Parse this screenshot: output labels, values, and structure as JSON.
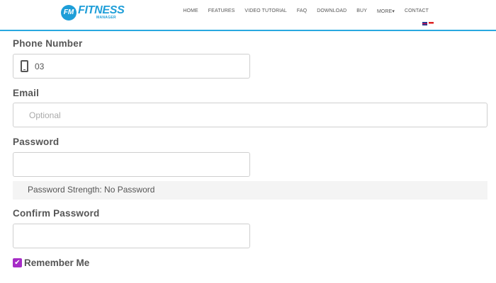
{
  "header": {
    "logo_badge": "FM",
    "logo_word": "FITNESS",
    "logo_sub": "MANAGER",
    "nav": [
      "HOME",
      "FEATURES",
      "VIDEO TUTORIAL",
      "FAQ",
      "DOWNLOAD",
      "BUY",
      "MORE▾",
      "CONTACT"
    ],
    "accent_color": "#29a8e0"
  },
  "form": {
    "phone": {
      "label": "Phone Number",
      "value": "03",
      "icon": "phone-icon"
    },
    "email": {
      "label": "Email",
      "placeholder": "Optional"
    },
    "password": {
      "label": "Password",
      "strength_text": "Password Strength: No Password"
    },
    "confirm_password": {
      "label": "Confirm Password"
    },
    "remember": {
      "label": "Remember Me",
      "checked": true,
      "check_color": "#a62cc6"
    }
  }
}
